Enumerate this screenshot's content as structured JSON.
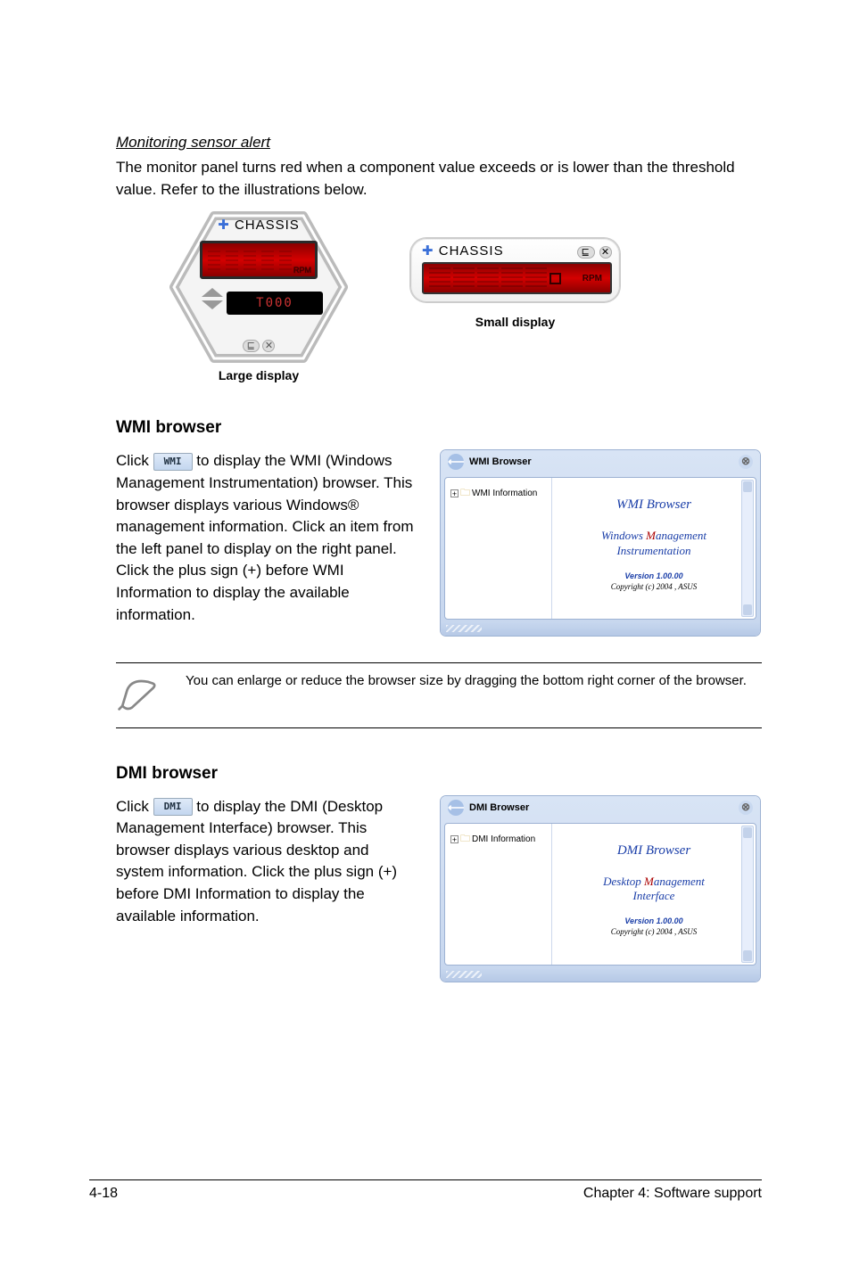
{
  "monitoring_alert": {
    "heading": "Monitoring sensor alert",
    "body": "The monitor panel turns red when a component value exceeds or is lower than the threshold value. Refer to the illustrations below."
  },
  "sensor_widgets": {
    "chassis_label": "CHASSIS",
    "rpm_label": "RPM",
    "large_readout": "T000",
    "large_caption": "Large display",
    "small_caption": "Small display"
  },
  "wmi": {
    "heading": "WMI browser",
    "btn_label": "WMI",
    "text_before_btn": "Click ",
    "text_after_btn": " to display the WMI (Windows Management Instrumentation) browser. This browser displays various Windows® management information. Click an item from the left panel to display on the right panel. Click the plus sign (+) before WMI Information to display the available information.",
    "window": {
      "title": "WMI Browser",
      "tree_item": "WMI Information",
      "right_title": "WMI Browser",
      "sub_line1_blue": "Windows ",
      "sub_line1_red": "M",
      "sub_line1_rest": "anagement",
      "sub_line2": "Instrumentation",
      "version": "Version 1.00.00",
      "copyright": "Copyright (c) 2004 , ASUS"
    }
  },
  "note_text": "You can enlarge or reduce the browser size by dragging the bottom right corner of the browser.",
  "dmi": {
    "heading": "DMI browser",
    "btn_label": "DMI",
    "text_before_btn": "Click ",
    "text_after_btn": " to display the DMI (Desktop Management Interface) browser. This browser displays various desktop and system information. Click the plus sign (+) before DMI Information to display the available information.",
    "window": {
      "title": "DMI Browser",
      "tree_item": "DMI Information",
      "right_title": "DMI Browser",
      "sub_line1_blue": "Desktop ",
      "sub_line1_red": "M",
      "sub_line1_rest": "anagement",
      "sub_line2": "Interface",
      "version": "Version 1.00.00",
      "copyright": "Copyright (c) 2004 , ASUS"
    }
  },
  "footer": {
    "left": "4-18",
    "right": "Chapter 4: Software support"
  }
}
